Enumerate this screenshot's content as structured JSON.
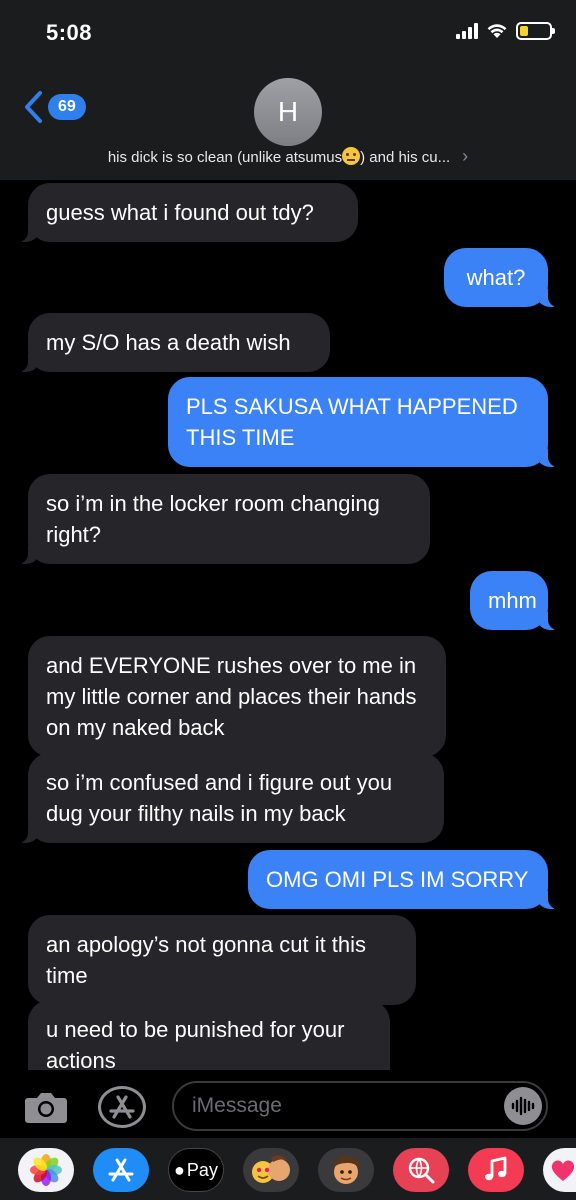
{
  "status_bar": {
    "time": "5:08"
  },
  "header": {
    "back_badge": "69",
    "avatar_initial": "H",
    "contact_name_before_emoji": "his dick is so clean (unlike atsumus",
    "contact_name_after_emoji": ") and his cu...",
    "emoji_icon": "neutral-face-emoji"
  },
  "messages": [
    {
      "direction": "incoming",
      "text": "guess what i found out tdy?"
    },
    {
      "direction": "outgoing",
      "text": "what?"
    },
    {
      "direction": "incoming",
      "text": "my S/O has a death wish"
    },
    {
      "direction": "outgoing",
      "text": "PLS SAKUSA WHAT HAPPENED THIS TIME"
    },
    {
      "direction": "incoming",
      "text": "so i’m in the locker room changing right?"
    },
    {
      "direction": "outgoing",
      "text": "mhm"
    },
    {
      "direction": "incoming",
      "text": "and EVERYONE rushes over to me in my little corner and places their hands on my naked back"
    },
    {
      "direction": "incoming",
      "text": "so i’m confused and i figure out you dug your filthy nails in my back"
    },
    {
      "direction": "outgoing",
      "text": "OMG OMI PLS IM SORRY"
    },
    {
      "direction": "incoming",
      "text": "an apology’s not gonna cut it this time"
    },
    {
      "direction": "incoming",
      "text": "u need to be punished for your actions"
    }
  ],
  "composer": {
    "placeholder": "iMessage"
  },
  "app_drawer": {
    "apple_pay_label": "Pay",
    "apps": [
      "photos-icon",
      "app-store-icon",
      "apple-pay-icon",
      "memoji-stickers-icon",
      "memoji-icon",
      "web-images-icon",
      "music-icon",
      "digital-touch-icon"
    ]
  },
  "colors": {
    "incoming_bubble": "#26262a",
    "outgoing_bubble": "#3b82f6",
    "accent": "#2f80ed",
    "battery": "#f5d230"
  }
}
